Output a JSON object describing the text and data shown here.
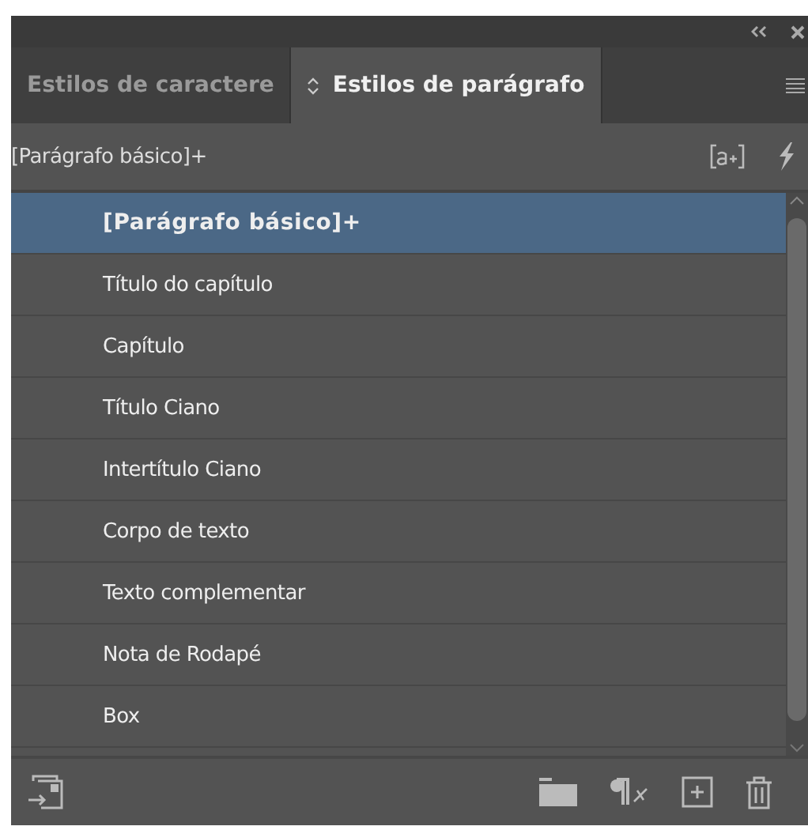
{
  "tabs": [
    {
      "label": "Estilos de caractere",
      "selected": false
    },
    {
      "label": "Estilos de parágrafo",
      "selected": true
    }
  ],
  "current_style": "[Parágrafo básico]+",
  "styles": [
    {
      "label": "[Parágrafo básico]+",
      "selected": true
    },
    {
      "label": "Título do capítulo",
      "selected": false
    },
    {
      "label": "Capítulo",
      "selected": false
    },
    {
      "label": "Título Ciano",
      "selected": false
    },
    {
      "label": "Intertítulo Ciano",
      "selected": false
    },
    {
      "label": "Corpo de texto",
      "selected": false
    },
    {
      "label": "Texto complementar",
      "selected": false
    },
    {
      "label": "Nota de Rodapé",
      "selected": false
    },
    {
      "label": "Box",
      "selected": false
    }
  ]
}
